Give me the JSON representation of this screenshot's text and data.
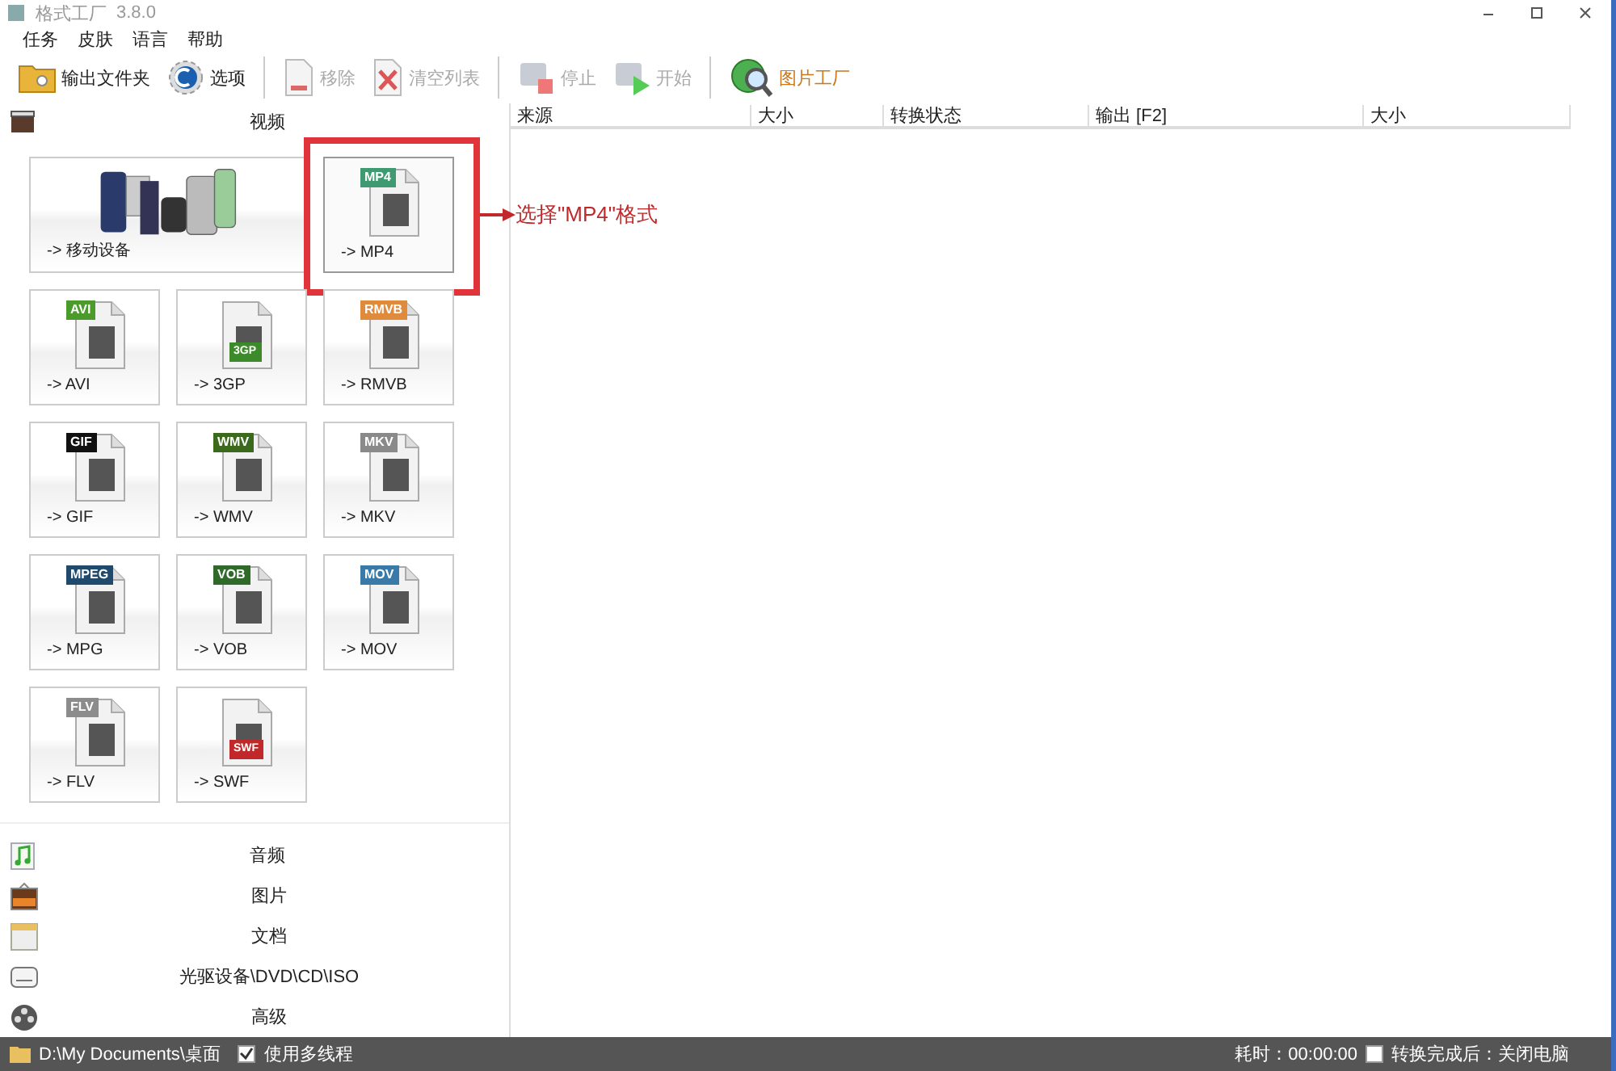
{
  "window": {
    "title": "格式工厂",
    "version": "3.8.0"
  },
  "menu": [
    "任务",
    "皮肤",
    "语言",
    "帮助"
  ],
  "toolbar": [
    {
      "label": "输出文件夹",
      "kind": "folder",
      "disabled": false
    },
    {
      "label": "选项",
      "kind": "options",
      "disabled": false
    },
    {
      "label": "移除",
      "kind": "remove",
      "disabled": true
    },
    {
      "label": "清空列表",
      "kind": "clear",
      "disabled": true
    },
    {
      "label": "停止",
      "kind": "stop",
      "disabled": true
    },
    {
      "label": "开始",
      "kind": "start",
      "disabled": true
    },
    {
      "label": "图片工厂",
      "kind": "globe",
      "disabled": false,
      "color": "#c8781e"
    }
  ],
  "video_panel": {
    "title": "视频",
    "tiles": [
      {
        "label": "-> 移动设备",
        "kind": "devices",
        "highlighted": false
      },
      {
        "label": "-> MP4",
        "kind": "file",
        "badge": "MP4",
        "badge_bottom": false,
        "color": "#3f9a72",
        "highlighted": true
      },
      {
        "label": "-> AVI",
        "kind": "file",
        "badge": "AVI",
        "badge_bottom": false,
        "color": "#4b9a2c",
        "highlighted": false
      },
      {
        "label": "-> 3GP",
        "kind": "file",
        "badge": "3GP",
        "badge_bottom": true,
        "color": "#3d8a2a",
        "highlighted": false
      },
      {
        "label": "-> RMVB",
        "kind": "file",
        "badge": "RMVB",
        "badge_bottom": false,
        "color": "#e08a3c",
        "highlighted": false
      },
      {
        "label": "-> GIF",
        "kind": "file",
        "badge": "GIF",
        "badge_bottom": false,
        "color": "#111111",
        "highlighted": false
      },
      {
        "label": "-> WMV",
        "kind": "file",
        "badge": "WMV",
        "badge_bottom": false,
        "color": "#3b6a1c",
        "highlighted": false
      },
      {
        "label": "-> MKV",
        "kind": "file",
        "badge": "MKV",
        "badge_bottom": false,
        "color": "#8a8a8a",
        "highlighted": false
      },
      {
        "label": "-> MPG",
        "kind": "file",
        "badge": "MPEG",
        "badge_bottom": false,
        "color": "#1f4a6e",
        "highlighted": false
      },
      {
        "label": "-> VOB",
        "kind": "file",
        "badge": "VOB",
        "badge_bottom": false,
        "color": "#2f6a2a",
        "highlighted": false
      },
      {
        "label": "-> MOV",
        "kind": "file",
        "badge": "MOV",
        "badge_bottom": false,
        "color": "#3a7aa8",
        "highlighted": false
      },
      {
        "label": "-> FLV",
        "kind": "file",
        "badge": "FLV",
        "badge_bottom": false,
        "color": "#8c8c8c",
        "highlighted": false
      },
      {
        "label": "-> SWF",
        "kind": "file",
        "badge": "SWF",
        "badge_bottom": true,
        "color": "#c0282a",
        "highlighted": false
      }
    ]
  },
  "annotation": {
    "text": "选择\"MP4\"格式"
  },
  "categories": [
    {
      "label": "音频",
      "kind": "audio"
    },
    {
      "label": "图片",
      "kind": "picture"
    },
    {
      "label": "文档",
      "kind": "document"
    },
    {
      "label": "光驱设备\\DVD\\CD\\ISO",
      "kind": "disc"
    },
    {
      "label": "高级",
      "kind": "advanced"
    }
  ],
  "table": {
    "columns": [
      "来源",
      "大小",
      "转换状态",
      "输出 [F2]",
      "大小"
    ]
  },
  "status_bar": {
    "path": "D:\\My Documents\\桌面",
    "multithread": {
      "label": "使用多线程",
      "checked": true
    },
    "elapsed": "耗时：00:00:00",
    "shutdown": {
      "label": "转换完成后：关闭电脑",
      "checked": false
    }
  }
}
